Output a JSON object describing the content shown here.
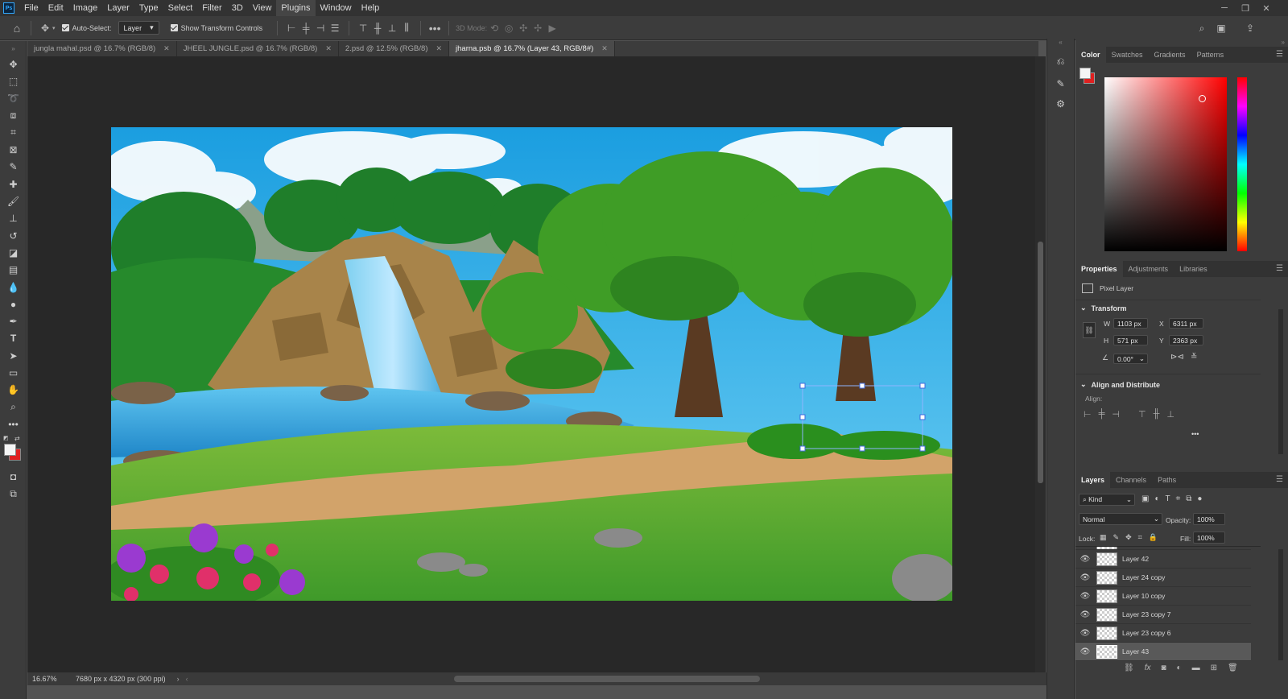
{
  "app": {
    "logo": "Ps"
  },
  "menu": [
    "File",
    "Edit",
    "Image",
    "Layer",
    "Type",
    "Select",
    "Filter",
    "3D",
    "View",
    "Plugins",
    "Window",
    "Help"
  ],
  "active_menu": "Plugins",
  "options": {
    "auto_select_label": "Auto-Select:",
    "auto_select_target": "Layer",
    "show_transform_label": "Show Transform Controls",
    "mode_3d_label": "3D Mode:"
  },
  "tabs": [
    {
      "label": "jungla mahal.psd @ 16.7% (RGB/8)",
      "active": false
    },
    {
      "label": "JHEEL JUNGLE.psd @ 16.7% (RGB/8)",
      "active": false
    },
    {
      "label": "2.psd @ 12.5% (RGB/8)",
      "active": false
    },
    {
      "label": "jharna.psb @ 16.7% (Layer 43, RGB/8#)",
      "active": true
    }
  ],
  "status": {
    "zoom": "16.67%",
    "doc_info": "7680 px x 4320 px (300 ppi)"
  },
  "color_panel": {
    "tabs": [
      "Color",
      "Swatches",
      "Gradients",
      "Patterns"
    ],
    "foreground": "#f5f5f5",
    "background": "#e02020",
    "hue": "#ff0000"
  },
  "properties": {
    "tabs": [
      "Properties",
      "Adjustments",
      "Libraries"
    ],
    "type": "Pixel Layer",
    "transform_title": "Transform",
    "w_label": "W",
    "w": "1103 px",
    "h_label": "H",
    "h": "571 px",
    "x_label": "X",
    "x": "6311 px",
    "y_label": "Y",
    "y": "2363 px",
    "angle": "0.00°",
    "align_title": "Align and Distribute",
    "align_label": "Align:",
    "more": "•••"
  },
  "layers_panel": {
    "tabs": [
      "Layers",
      "Channels",
      "Paths"
    ],
    "filter_kind": "Kind",
    "blend_mode": "Normal",
    "opacity_label": "Opacity:",
    "opacity": "100%",
    "lock_label": "Lock:",
    "fill_label": "Fill:",
    "fill": "100%",
    "layers": [
      "Layer 42",
      "Layer 24 copy",
      "Layer 10 copy",
      "Layer 23 copy 7",
      "Layer 23 copy 6",
      "Layer 43"
    ],
    "selected": "Layer 43"
  }
}
